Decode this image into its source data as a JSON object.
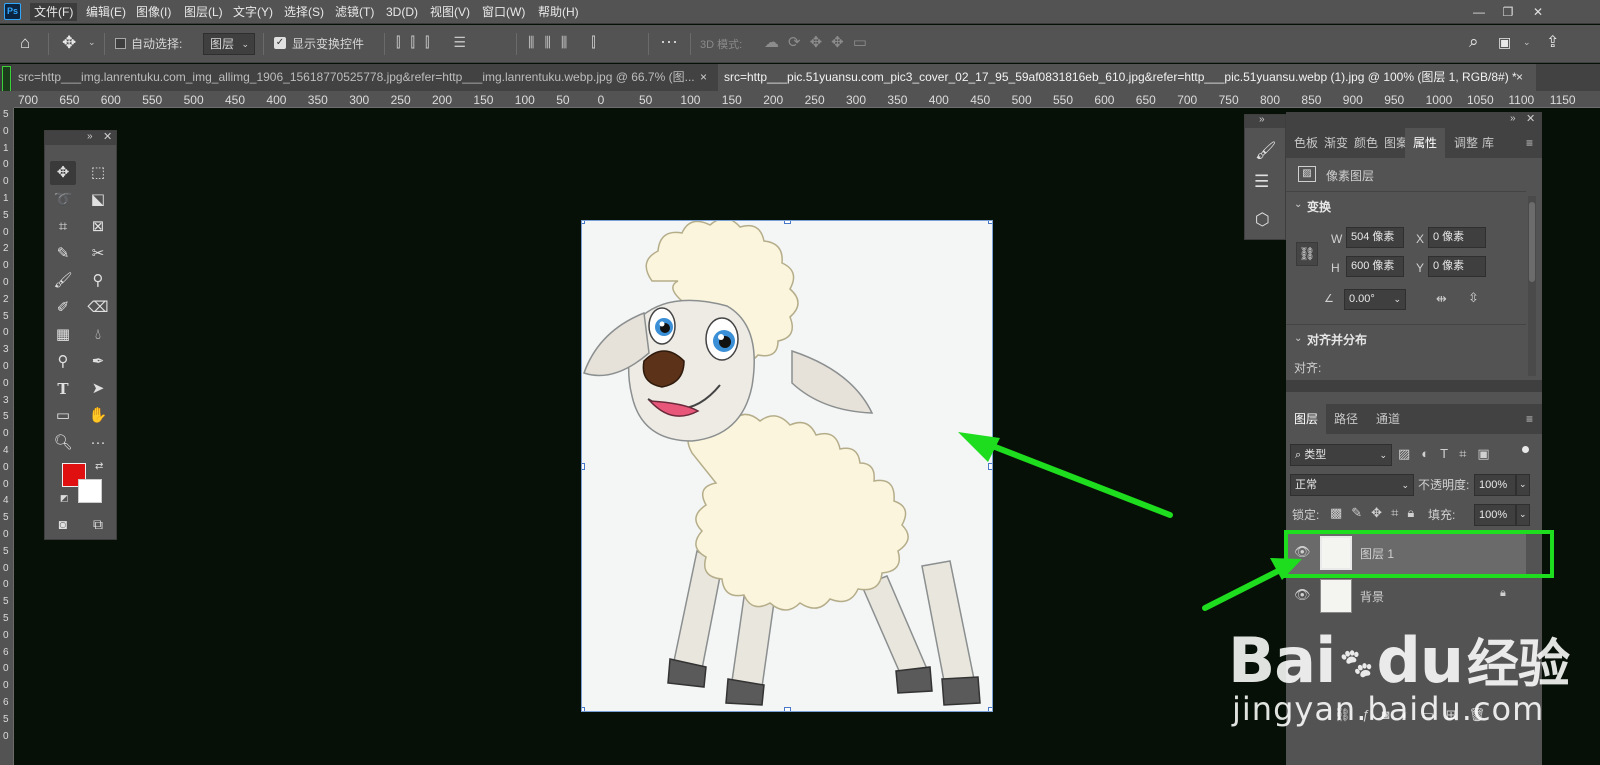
{
  "app": {
    "logo": "Ps"
  },
  "menu": [
    "文件(F)",
    "编辑(E)",
    "图像(I)",
    "图层(L)",
    "文字(Y)",
    "选择(S)",
    "滤镜(T)",
    "3D(D)",
    "视图(V)",
    "窗口(W)",
    "帮助(H)"
  ],
  "options": {
    "auto_select_label": "自动选择:",
    "auto_select_value": "图层",
    "show_transform_label": "显示变换控件",
    "mode_3d_label": "3D 模式:"
  },
  "tabs": [
    {
      "title": "src=http___img.lanrentuku.com_img_allimg_1906_15618770525778.jpg&refer=http___img.lanrentuku.webp.jpg @ 66.7% (图...",
      "close": "×"
    },
    {
      "title": "src=http___pic.51yuansu.com_pic3_cover_02_17_95_59af0831816eb_610.jpg&refer=http___pic.51yuansu.webp (1).jpg @ 100% (图层 1, RGB/8#) *",
      "close": "×"
    }
  ],
  "ruler_h": [
    "700",
    "650",
    "600",
    "550",
    "500",
    "450",
    "400",
    "350",
    "300",
    "250",
    "200",
    "150",
    "100",
    "50",
    "0",
    "50",
    "100",
    "150",
    "200",
    "250",
    "300",
    "350",
    "400",
    "450",
    "500",
    "550",
    "600",
    "650",
    "700",
    "750",
    "800",
    "850",
    "900",
    "950",
    "1000",
    "1050",
    "1100",
    "1150"
  ],
  "ruler_v": [
    "5",
    "0",
    "1",
    "0",
    "0",
    "1",
    "5",
    "0",
    "2",
    "0",
    "0",
    "2",
    "5",
    "0",
    "3",
    "0",
    "0",
    "3",
    "5",
    "0",
    "4",
    "0",
    "0",
    "4",
    "5",
    "0",
    "5",
    "0",
    "0",
    "5",
    "5",
    "0",
    "6",
    "0",
    "0",
    "6",
    "5",
    "0"
  ],
  "properties": {
    "tabs": [
      "色板",
      "渐变",
      "颜色",
      "图案",
      "属性",
      "调整",
      "库"
    ],
    "active_tab": "属性",
    "layer_type": "像素图层",
    "transform_title": "变换",
    "w_label": "W",
    "w_value": "504 像素",
    "h_label": "H",
    "h_value": "600 像素",
    "x_label": "X",
    "x_value": "0 像素",
    "y_label": "Y",
    "y_value": "0 像素",
    "angle_value": "0.00°",
    "align_title": "对齐并分布",
    "align_label": "对齐:"
  },
  "layers": {
    "tabs": [
      "图层",
      "路径",
      "通道"
    ],
    "filter_label": "类型",
    "blend_mode": "正常",
    "opacity_label": "不透明度:",
    "opacity_value": "100%",
    "lock_label": "锁定:",
    "fill_label": "填充:",
    "fill_value": "100%",
    "items": [
      {
        "name": "图层 1",
        "selected": true
      },
      {
        "name": "背景",
        "locked": true
      }
    ]
  },
  "colors": {
    "foreground": "#e01010",
    "background": "#ffffff",
    "annotation": "#1edc1e"
  },
  "watermark": {
    "brand": "Bai",
    "brand2": "du",
    "brand_cn": "经验",
    "url": "jingyan.baidu.com"
  }
}
